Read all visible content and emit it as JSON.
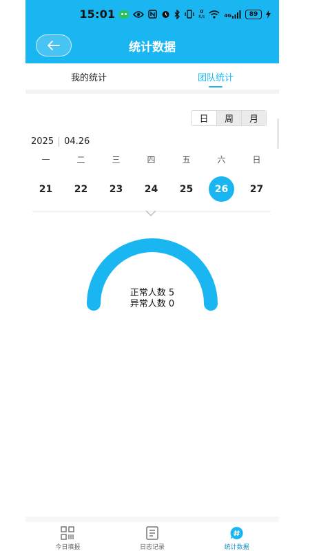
{
  "status_bar": {
    "time": "15:01",
    "speed_unit": "K/s",
    "network": "4G",
    "battery": "89"
  },
  "header": {
    "title": "统计数据"
  },
  "tabs": [
    {
      "label": "我的统计",
      "active": false
    },
    {
      "label": "团队统计",
      "active": true
    }
  ],
  "segment": [
    {
      "label": "日",
      "active": true
    },
    {
      "label": "周",
      "active": false
    },
    {
      "label": "月",
      "active": false
    }
  ],
  "date": {
    "year": "2025",
    "month_day": "04.26"
  },
  "weekdays": [
    "一",
    "二",
    "三",
    "四",
    "五",
    "六",
    "日"
  ],
  "days": [
    {
      "num": "21",
      "selected": false
    },
    {
      "num": "22",
      "selected": false
    },
    {
      "num": "23",
      "selected": false
    },
    {
      "num": "24",
      "selected": false
    },
    {
      "num": "25",
      "selected": false
    },
    {
      "num": "26",
      "selected": true
    },
    {
      "num": "27",
      "selected": false
    }
  ],
  "stats": {
    "normal": "正常人数 5",
    "abnormal": "异常人数 0"
  },
  "bottom_nav": [
    {
      "label": "今日填报",
      "icon": "qr-grid-icon",
      "active": false
    },
    {
      "label": "日志记录",
      "icon": "document-icon",
      "active": false
    },
    {
      "label": "统计数据",
      "icon": "hash-chat-icon",
      "active": true
    }
  ],
  "colors": {
    "accent": "#1ab6f2"
  }
}
